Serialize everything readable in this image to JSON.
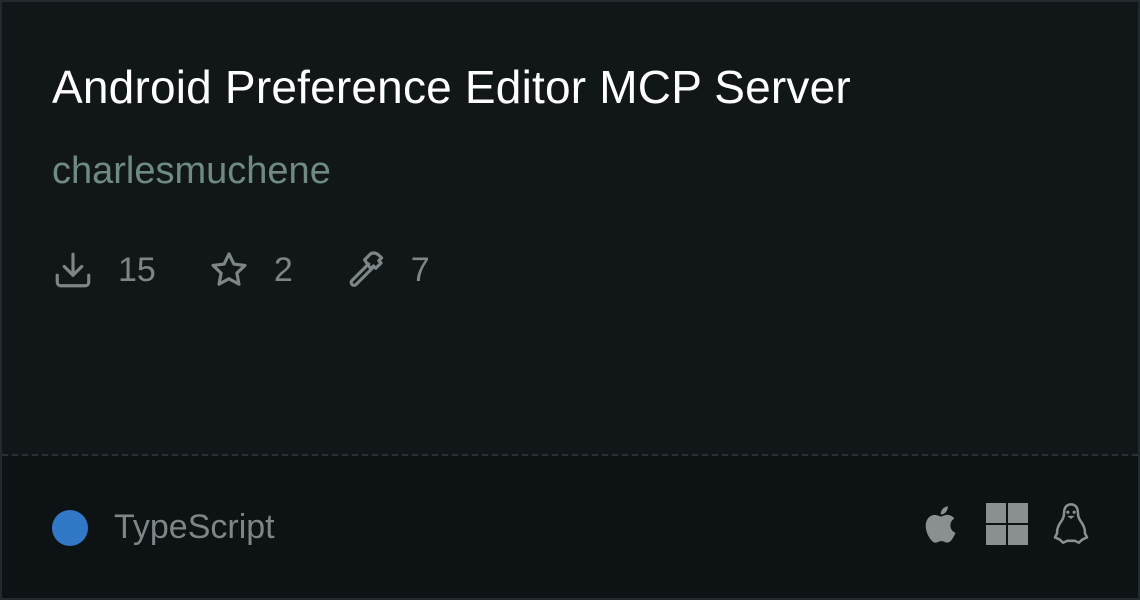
{
  "server": {
    "title": "Android Preference Editor MCP Server",
    "author": "charlesmuchene"
  },
  "stats": {
    "downloads": "15",
    "stars": "2",
    "tools": "7"
  },
  "footer": {
    "language": "TypeScript",
    "language_color": "#3178c6",
    "platforms": [
      "apple-icon",
      "windows-icon",
      "linux-icon"
    ]
  }
}
